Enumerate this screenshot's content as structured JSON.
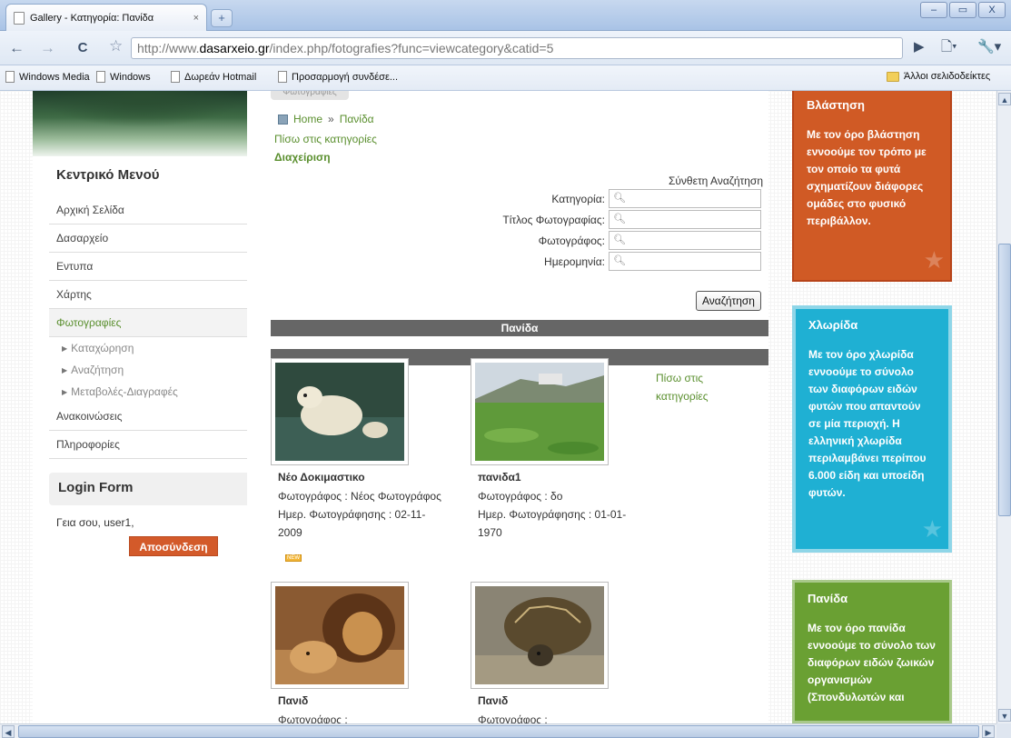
{
  "browser": {
    "tab_title": "Gallery - Κατηγορία: Πανίδα",
    "tab_close": "×",
    "new_tab": "+",
    "window_buttons": [
      "–",
      "▭",
      "X"
    ],
    "url_prefix": "http://www.",
    "url_host": "dasarxeio.gr",
    "url_path": "/index.php/fotografies?func=viewcategory&catid=5",
    "bookmarks": [
      "Windows Media",
      "Windows",
      "Δωρεάν Hotmail",
      "Προσαρμογή συνδέσε..."
    ],
    "other_bookmarks": "Άλλοι σελιδοδείκτες"
  },
  "sidebar": {
    "menu_title": "Κεντρικό Μενού",
    "items": [
      {
        "label": "Αρχική Σελίδα"
      },
      {
        "label": "Δασαρχείο"
      },
      {
        "label": "Εντυπα"
      },
      {
        "label": "Χάρτης"
      },
      {
        "label": "Φωτογραφίες"
      }
    ],
    "subitems": [
      {
        "label": "Καταχώρηση"
      },
      {
        "label": "Αναζήτηση"
      },
      {
        "label": "Μεταβολές-Διαγραφές"
      }
    ],
    "items_after": [
      {
        "label": "Ανακοινώσεις"
      },
      {
        "label": "Πληροφορίες"
      }
    ],
    "login_title": "Login Form",
    "greeting": "Γεια σου, user1,",
    "logout_label": "Αποσύνδεση"
  },
  "main": {
    "top_tab": "Φωτογραφίες",
    "breadcrumb_home": "Home",
    "breadcrumb_sep": "»",
    "breadcrumb_current": "Πανίδα",
    "back_to_categories": "Πίσω στις κατηγορίες",
    "admin": "Διαχείριση",
    "advanced_search": "Σύνθετη Αναζήτηση",
    "search_fields": [
      {
        "label": "Κατηγορία:",
        "value": ""
      },
      {
        "label": "Τίτλος Φωτογραφίας:",
        "value": ""
      },
      {
        "label": "Φωτογράφος:",
        "value": ""
      },
      {
        "label": "Ημερομηνία:",
        "value": ""
      }
    ],
    "search_button": "Αναζήτηση",
    "category_header": "Πανίδα",
    "back_link_right": "Πίσω στις κατηγορίες",
    "photos": [
      {
        "title": "Νέο Δοκιμαστικο",
        "photographer": "Φωτογράφος : Νέος Φωτογράφος",
        "date_label": "Ημερ. Φωτογράφησης : 02-11-",
        "date_cont": "2009",
        "badge": "NEW"
      },
      {
        "title": "πανιδα1",
        "photographer": "Φωτογράφος : δο",
        "date_label": "Ημερ. Φωτογράφησης : 01-01-",
        "date_cont": "1970"
      },
      {
        "title": "Πανιδ",
        "photographer": "Φωτογράφος :"
      },
      {
        "title": "Πανιδ",
        "photographer": "Φωτογράφος :"
      }
    ]
  },
  "right": {
    "boxes": [
      {
        "title": "Βλάστηση",
        "text": "Με τον όρο βλάστηση εννοούμε τον τρόπο με τον οποίο τα φυτά σχηματίζουν διάφορες ομάδες στο φυσικό περιβάλλον."
      },
      {
        "title": "Χλωρίδα",
        "text": "Με τον όρο χλωρίδα εννοούμε το σύνολο των διαφόρων ειδών φυτών που απαντούν σε μία περιοχή. Η ελληνική χλωρίδα περιλαμβάνει περίπου 6.000 είδη και υποείδη φυτών."
      },
      {
        "title": "Πανίδα",
        "text": "Με τον όρο πανίδα εννοούμε το σύνολο των διαφόρων ειδών ζωικών οργανισμών (Σπονδυλωτών και"
      }
    ]
  }
}
